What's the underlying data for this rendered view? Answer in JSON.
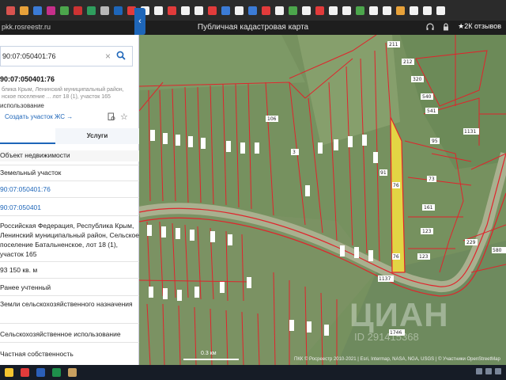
{
  "browser": {
    "url": "pkk.rosreestr.ru",
    "page_title": "Публичная кадастровая карта",
    "reviews": "2К отзывов"
  },
  "search": {
    "value": "90:07:050401:76",
    "placeholder": ""
  },
  "parcel": {
    "cad_id": "90:07:050401:76",
    "address_short": "блика Крым, Ленинский муниципальный район, нское поселение ... лот 18 (1), участок 165",
    "usage": "использование",
    "create_link": "Создать участок ЖС →"
  },
  "tabs": {
    "info": "",
    "services": "Услуги"
  },
  "fields": [
    {
      "text": "Объект недвижимости",
      "kind": "label"
    },
    {
      "text": "Земельный участок",
      "kind": "value"
    },
    {
      "text": "90:07:050401:76",
      "kind": "link"
    },
    {
      "text": "90:07:050401",
      "kind": "link"
    },
    {
      "text": "Российская Федерация, Республика Крым, Ленинский муниципальный район, Сельское поселение Батальненское, лот 18 (1), участок 165",
      "kind": "value"
    },
    {
      "text": "93 150 кв. м",
      "kind": "value"
    },
    {
      "text": "Ранее учтенный",
      "kind": "value"
    },
    {
      "text": "Земли сельскохозяйственного назначения",
      "kind": "value"
    },
    {
      "text": "Сельскохозяйственное использование",
      "kind": "value"
    },
    {
      "text": "Частная собственность",
      "kind": "value"
    }
  ],
  "map": {
    "attribution": "ПКК © Росреестр 2010-2021 | Esri, Intermap, NASA, NGA, USGS | © Участники OpenStreetMap",
    "scale_label": "0.3 км",
    "watermark": "ЦИАН",
    "watermark_id": "ID 291415368",
    "parcel_labels": [
      "211",
      "212",
      "320",
      "540",
      "541",
      "95",
      "73",
      "161",
      "123",
      "123",
      "229",
      "580",
      "106",
      "1131",
      "1137",
      "1746",
      "76",
      "76",
      "3",
      "91",
      "1",
      "1",
      "1",
      "1",
      "1",
      "1",
      "1",
      "1",
      "1",
      "1",
      "1"
    ]
  },
  "colors": {
    "accent": "#1e66b9",
    "parcel_line": "#e0242c",
    "selected_parcel": "#e3d544",
    "sidebar_bg": "#ffffff"
  },
  "icons": [
    "search-icon",
    "clear-icon",
    "chevron-left-icon",
    "document-icon",
    "star-icon",
    "headphones-icon",
    "lock-icon",
    "star-reviews-icon"
  ]
}
